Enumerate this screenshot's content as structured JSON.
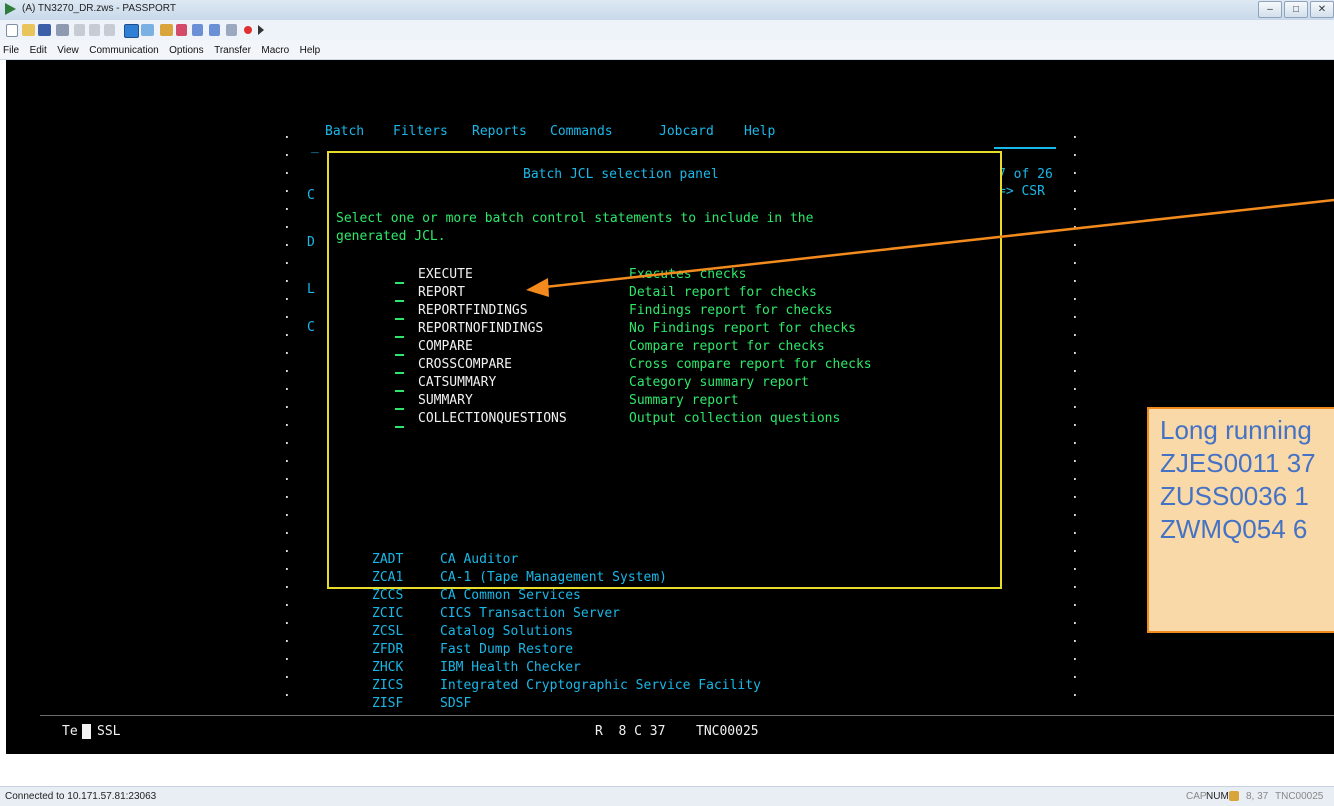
{
  "window": {
    "title": "(A) TN3270_DR.zws - PASSPORT",
    "controls": [
      "–",
      "□",
      "✕"
    ]
  },
  "menubar": [
    "File",
    "Edit",
    "View",
    "Communication",
    "Options",
    "Transfer",
    "Macro",
    "Help"
  ],
  "toolbar_icons": [
    "new-icon",
    "open-icon",
    "save-icon",
    "print-icon",
    "cut-icon",
    "copy-icon",
    "paste-icon",
    "connect-icon",
    "disconnect-icon",
    "font-icon",
    "color-icon",
    "transfer-send-icon",
    "transfer-receive-icon",
    "macro-icon",
    "record-icon",
    "play-icon"
  ],
  "terminal": {
    "action_bar": [
      "Batch",
      "Filters",
      "Reports",
      "Commands",
      "Jobcard",
      "Help"
    ],
    "left_letters": [
      "C",
      "D",
      "L",
      "C"
    ],
    "panel": {
      "title": "Batch JCL selection panel",
      "position": "7 of 26",
      "scroll": "=> CSR",
      "instructions": [
        "Select one or more batch control statements to include in the",
        "generated JCL."
      ],
      "options": [
        {
          "name": "EXECUTE",
          "desc": "Executes checks"
        },
        {
          "name": "REPORT",
          "desc": "Detail report for checks"
        },
        {
          "name": "REPORTFINDINGS",
          "desc": "Findings report for checks"
        },
        {
          "name": "REPORTNOFINDINGS",
          "desc": "No Findings report for checks"
        },
        {
          "name": "COMPARE",
          "desc": "Compare report for checks"
        },
        {
          "name": "CROSSCOMPARE",
          "desc": "Cross compare report for checks"
        },
        {
          "name": "CATSUMMARY",
          "desc": "Category summary report"
        },
        {
          "name": "SUMMARY",
          "desc": "Summary report"
        },
        {
          "name": "COLLECTIONQUESTIONS",
          "desc": "Output collection questions"
        }
      ]
    },
    "products": [
      {
        "code": "ZADT",
        "name": "CA Auditor"
      },
      {
        "code": "ZCA1",
        "name": "CA-1 (Tape Management System)"
      },
      {
        "code": "ZCCS",
        "name": "CA Common Services"
      },
      {
        "code": "ZCIC",
        "name": "CICS Transaction Server"
      },
      {
        "code": "ZCSL",
        "name": "Catalog Solutions"
      },
      {
        "code": "ZFDR",
        "name": "Fast Dump Restore"
      },
      {
        "code": "ZHCK",
        "name": "IBM Health Checker"
      },
      {
        "code": "ZICS",
        "name": "Integrated Cryptographic Service Facility"
      },
      {
        "code": "ZISF",
        "name": "SDSF"
      }
    ],
    "oia": {
      "left": "Te",
      "ssl": "SSL",
      "cursor": "R  8 C 37",
      "lu": "TNC00025"
    }
  },
  "callout": {
    "lines": [
      "Long running",
      "ZJES0011 37",
      "ZUSS0036 1",
      "ZWMQ054 6"
    ]
  },
  "status": {
    "connection": "Connected to 10.171.57.81:23063",
    "cap": "CAP",
    "num": "NUM",
    "position": "8, 37",
    "lu": "TNC00025"
  }
}
